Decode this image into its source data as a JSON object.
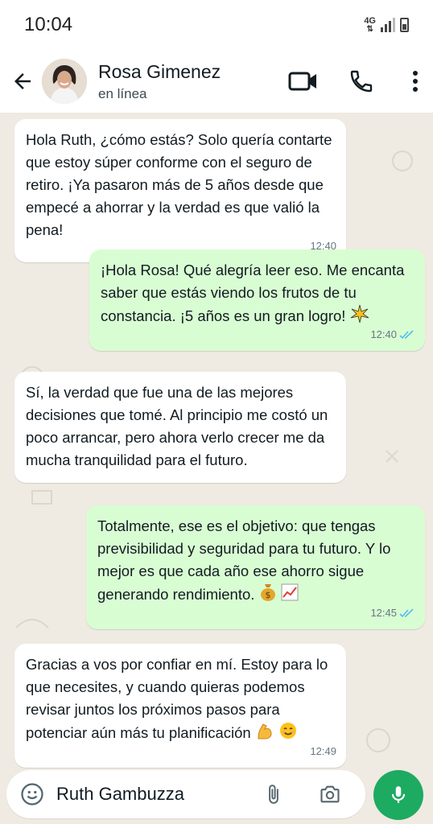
{
  "status_bar": {
    "time": "10:04",
    "network": "4G"
  },
  "header": {
    "contact_name": "Rosa Gimenez",
    "contact_status": "en línea",
    "icons": [
      "back-arrow-icon",
      "video-call-icon",
      "voice-call-icon",
      "more-options-icon"
    ]
  },
  "messages": [
    {
      "direction": "in",
      "text": "Hola Ruth, ¿cómo estás? Solo quería contarte que estoy súper conforme con el seguro de retiro. ¡Ya pasaron más de 5 años desde que empecé a ahorrar y la verdad es que valió la pena!",
      "time": "12:40"
    },
    {
      "direction": "out",
      "text": "¡Hola Rosa! Qué alegría leer eso. Me encanta saber que estás viendo los frutos de tu constancia. ¡5 años es un gran logro!",
      "emoji": "sparkle-burst",
      "time": "12:40",
      "read": true
    },
    {
      "direction": "in",
      "text": "Sí, la verdad que fue una de las mejores decisiones que tomé. Al principio me costó un poco arrancar, pero ahora verlo crecer me da mucha tranquilidad para el futuro.",
      "time": ""
    },
    {
      "direction": "out",
      "text": "Totalmente, ese es el objetivo: que tengas previsibilidad y seguridad para tu futuro. Y lo mejor es que cada año ese ahorro sigue generando rendimiento.",
      "emoji": "money-bag chart-increasing",
      "time": "12:45",
      "read": true
    },
    {
      "direction": "in",
      "text": "Gracias a vos por confiar en mí. Estoy para lo que necesites, y cuando quieras podemos revisar juntos los próximos pasos para potenciar aún más tu planificación",
      "emoji": "flexed-biceps smiling-face",
      "time": "12:49"
    }
  ],
  "composer": {
    "value": "Ruth Gambuzza"
  },
  "colors": {
    "outgoing_bubble": "#d9fdd3",
    "incoming_bubble": "#ffffff",
    "chat_background": "#efeae2",
    "mic_button": "#1daa61",
    "read_ticks": "#53bdeb"
  }
}
